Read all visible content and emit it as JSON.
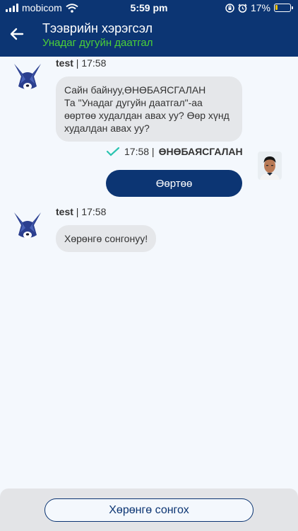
{
  "status_bar": {
    "carrier": "mobicom",
    "time": "5:59 pm",
    "battery": "17%",
    "battery_level": 0.17
  },
  "header": {
    "title": "Тээврийн хэрэгсэл",
    "subtitle": "Унадаг дугуйн даатгал"
  },
  "messages": [
    {
      "sender": "test",
      "time": "| 17:58",
      "text_lines": [
        "Сайн байнуу,ӨНӨБАЯСГАЛАН",
        "Та \"Унадаг дугуйн даатгал\"-аа",
        "өөртөө худалдан авах уу? Өөр хүнд",
        "худалдан авах уу?"
      ]
    },
    {
      "time": "17:58 |",
      "sender": "ӨНӨБАЯСГАЛАН",
      "text": "Өөртөө"
    },
    {
      "sender": "test",
      "time": "| 17:58",
      "text": "Хөрөнгө сонгонуу!"
    }
  ],
  "footer": {
    "button_label": "Хөрөнгө сонгох"
  },
  "colors": {
    "primary": "#0c3573",
    "accent_green": "#4cd137",
    "check": "#2bc4b0",
    "bubble": "#e5e7ea",
    "background": "#f4f8fd"
  },
  "icons": [
    "signal-icon",
    "wifi-icon",
    "orientation-lock-icon",
    "alarm-icon",
    "battery-icon",
    "back-arrow-icon",
    "bot-avatar-icon",
    "check-icon",
    "user-avatar"
  ]
}
